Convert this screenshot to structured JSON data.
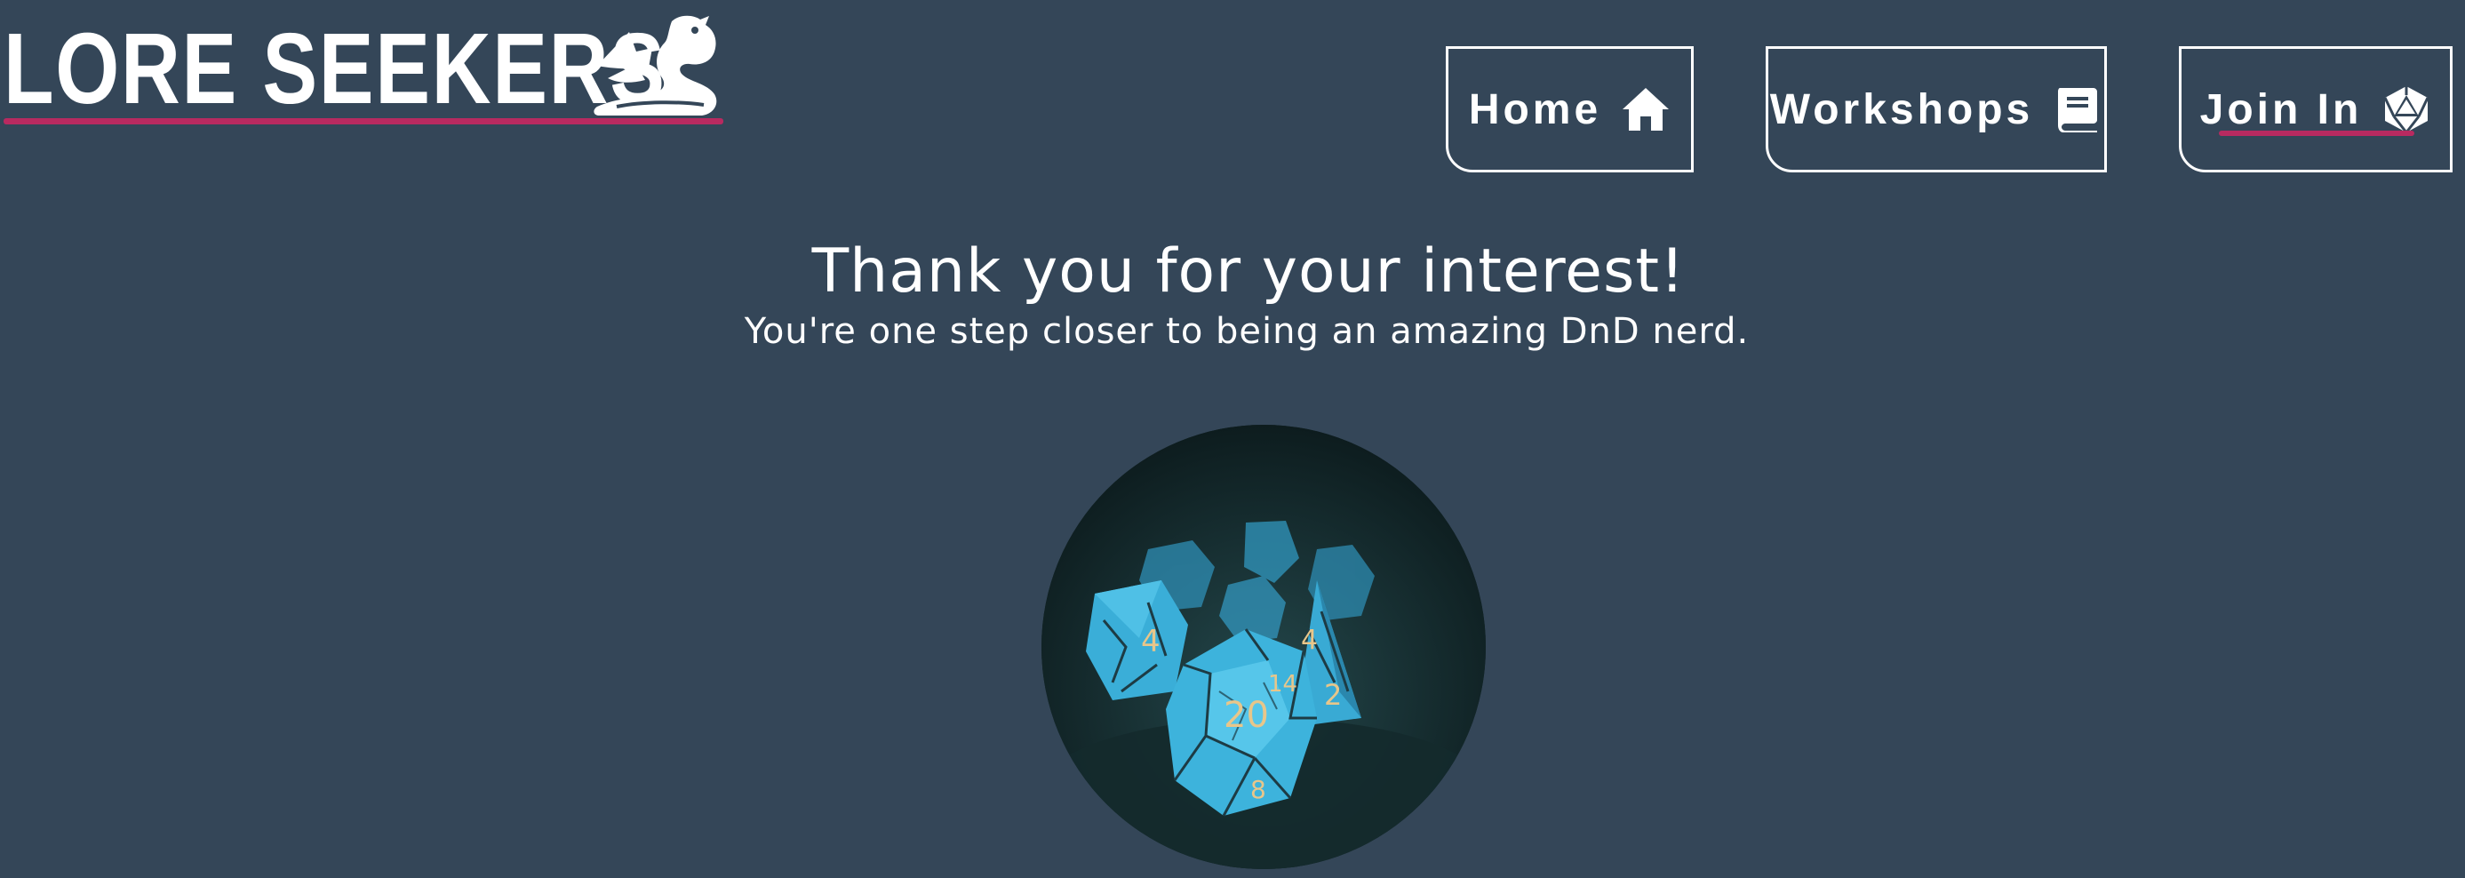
{
  "logo": {
    "text": "LORE SEEKERS",
    "icon": "dragon-icon",
    "underline_color": "#b82a60"
  },
  "nav": {
    "items": [
      {
        "label": "Home",
        "icon": "house-icon"
      },
      {
        "label": "Workshops",
        "icon": "book-icon"
      },
      {
        "label": "Join In",
        "icon": "d20-icon",
        "active": true
      }
    ],
    "active_underline_color": "#b82a60"
  },
  "hero": {
    "headline": "Thank you for your interest!",
    "subheadline": "You're one step closer to being an amazing DnD nerd."
  },
  "image": {
    "subject": "turquoise-dice-photo",
    "die_numbers": [
      "4",
      "20",
      "14",
      "2",
      "4",
      "8"
    ]
  },
  "colors": {
    "background": "#344658",
    "text": "#ffffff",
    "accent": "#b82a60",
    "dice": "#3aaed8"
  }
}
